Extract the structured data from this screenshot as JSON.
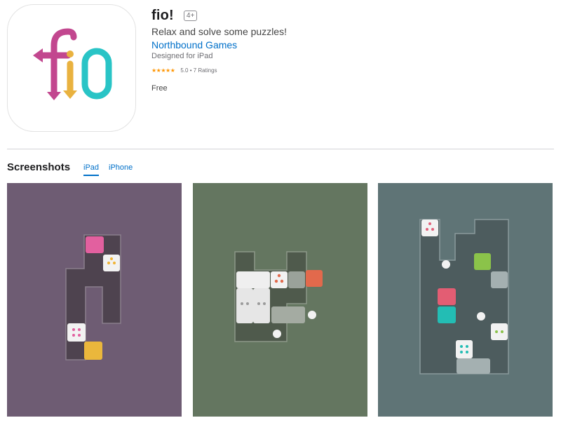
{
  "app": {
    "title": "fio!",
    "age_rating": "4+",
    "subtitle": "Relax and solve some puzzles!",
    "developer": "Northbound Games",
    "designed_for": "Designed for iPad",
    "stars_display": "★★★★★",
    "rating_value": 5.0,
    "ratings_text": "5.0 • 7 Ratings",
    "price": "Free",
    "icon_colors": {
      "f": "#c2478f",
      "i": "#e9b23f",
      "o": "#29c4c6"
    }
  },
  "screenshots": {
    "heading": "Screenshots",
    "tabs": [
      {
        "label": "iPad",
        "active": true
      },
      {
        "label": "iPhone",
        "active": false
      }
    ],
    "items": [
      {
        "name": "screenshot-1",
        "background": "#6e5c73"
      },
      {
        "name": "screenshot-2",
        "background": "#647660"
      },
      {
        "name": "screenshot-3",
        "background": "#5f7476"
      }
    ]
  }
}
